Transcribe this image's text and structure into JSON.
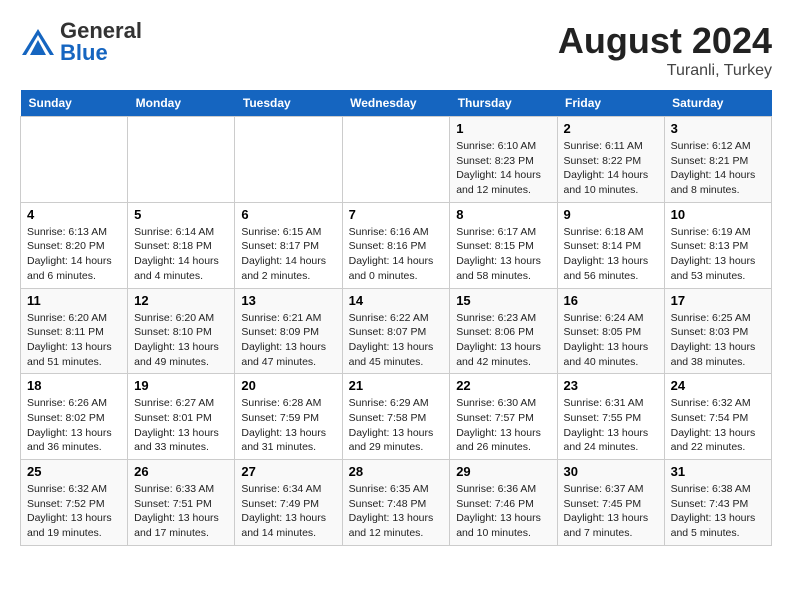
{
  "header": {
    "logo_general": "General",
    "logo_blue": "Blue",
    "month_year": "August 2024",
    "location": "Turanli, Turkey"
  },
  "weekdays": [
    "Sunday",
    "Monday",
    "Tuesday",
    "Wednesday",
    "Thursday",
    "Friday",
    "Saturday"
  ],
  "weeks": [
    [
      {
        "day": "",
        "info": ""
      },
      {
        "day": "",
        "info": ""
      },
      {
        "day": "",
        "info": ""
      },
      {
        "day": "",
        "info": ""
      },
      {
        "day": "1",
        "info": "Sunrise: 6:10 AM\nSunset: 8:23 PM\nDaylight: 14 hours\nand 12 minutes."
      },
      {
        "day": "2",
        "info": "Sunrise: 6:11 AM\nSunset: 8:22 PM\nDaylight: 14 hours\nand 10 minutes."
      },
      {
        "day": "3",
        "info": "Sunrise: 6:12 AM\nSunset: 8:21 PM\nDaylight: 14 hours\nand 8 minutes."
      }
    ],
    [
      {
        "day": "4",
        "info": "Sunrise: 6:13 AM\nSunset: 8:20 PM\nDaylight: 14 hours\nand 6 minutes."
      },
      {
        "day": "5",
        "info": "Sunrise: 6:14 AM\nSunset: 8:18 PM\nDaylight: 14 hours\nand 4 minutes."
      },
      {
        "day": "6",
        "info": "Sunrise: 6:15 AM\nSunset: 8:17 PM\nDaylight: 14 hours\nand 2 minutes."
      },
      {
        "day": "7",
        "info": "Sunrise: 6:16 AM\nSunset: 8:16 PM\nDaylight: 14 hours\nand 0 minutes."
      },
      {
        "day": "8",
        "info": "Sunrise: 6:17 AM\nSunset: 8:15 PM\nDaylight: 13 hours\nand 58 minutes."
      },
      {
        "day": "9",
        "info": "Sunrise: 6:18 AM\nSunset: 8:14 PM\nDaylight: 13 hours\nand 56 minutes."
      },
      {
        "day": "10",
        "info": "Sunrise: 6:19 AM\nSunset: 8:13 PM\nDaylight: 13 hours\nand 53 minutes."
      }
    ],
    [
      {
        "day": "11",
        "info": "Sunrise: 6:20 AM\nSunset: 8:11 PM\nDaylight: 13 hours\nand 51 minutes."
      },
      {
        "day": "12",
        "info": "Sunrise: 6:20 AM\nSunset: 8:10 PM\nDaylight: 13 hours\nand 49 minutes."
      },
      {
        "day": "13",
        "info": "Sunrise: 6:21 AM\nSunset: 8:09 PM\nDaylight: 13 hours\nand 47 minutes."
      },
      {
        "day": "14",
        "info": "Sunrise: 6:22 AM\nSunset: 8:07 PM\nDaylight: 13 hours\nand 45 minutes."
      },
      {
        "day": "15",
        "info": "Sunrise: 6:23 AM\nSunset: 8:06 PM\nDaylight: 13 hours\nand 42 minutes."
      },
      {
        "day": "16",
        "info": "Sunrise: 6:24 AM\nSunset: 8:05 PM\nDaylight: 13 hours\nand 40 minutes."
      },
      {
        "day": "17",
        "info": "Sunrise: 6:25 AM\nSunset: 8:03 PM\nDaylight: 13 hours\nand 38 minutes."
      }
    ],
    [
      {
        "day": "18",
        "info": "Sunrise: 6:26 AM\nSunset: 8:02 PM\nDaylight: 13 hours\nand 36 minutes."
      },
      {
        "day": "19",
        "info": "Sunrise: 6:27 AM\nSunset: 8:01 PM\nDaylight: 13 hours\nand 33 minutes."
      },
      {
        "day": "20",
        "info": "Sunrise: 6:28 AM\nSunset: 7:59 PM\nDaylight: 13 hours\nand 31 minutes."
      },
      {
        "day": "21",
        "info": "Sunrise: 6:29 AM\nSunset: 7:58 PM\nDaylight: 13 hours\nand 29 minutes."
      },
      {
        "day": "22",
        "info": "Sunrise: 6:30 AM\nSunset: 7:57 PM\nDaylight: 13 hours\nand 26 minutes."
      },
      {
        "day": "23",
        "info": "Sunrise: 6:31 AM\nSunset: 7:55 PM\nDaylight: 13 hours\nand 24 minutes."
      },
      {
        "day": "24",
        "info": "Sunrise: 6:32 AM\nSunset: 7:54 PM\nDaylight: 13 hours\nand 22 minutes."
      }
    ],
    [
      {
        "day": "25",
        "info": "Sunrise: 6:32 AM\nSunset: 7:52 PM\nDaylight: 13 hours\nand 19 minutes."
      },
      {
        "day": "26",
        "info": "Sunrise: 6:33 AM\nSunset: 7:51 PM\nDaylight: 13 hours\nand 17 minutes."
      },
      {
        "day": "27",
        "info": "Sunrise: 6:34 AM\nSunset: 7:49 PM\nDaylight: 13 hours\nand 14 minutes."
      },
      {
        "day": "28",
        "info": "Sunrise: 6:35 AM\nSunset: 7:48 PM\nDaylight: 13 hours\nand 12 minutes."
      },
      {
        "day": "29",
        "info": "Sunrise: 6:36 AM\nSunset: 7:46 PM\nDaylight: 13 hours\nand 10 minutes."
      },
      {
        "day": "30",
        "info": "Sunrise: 6:37 AM\nSunset: 7:45 PM\nDaylight: 13 hours\nand 7 minutes."
      },
      {
        "day": "31",
        "info": "Sunrise: 6:38 AM\nSunset: 7:43 PM\nDaylight: 13 hours\nand 5 minutes."
      }
    ]
  ]
}
